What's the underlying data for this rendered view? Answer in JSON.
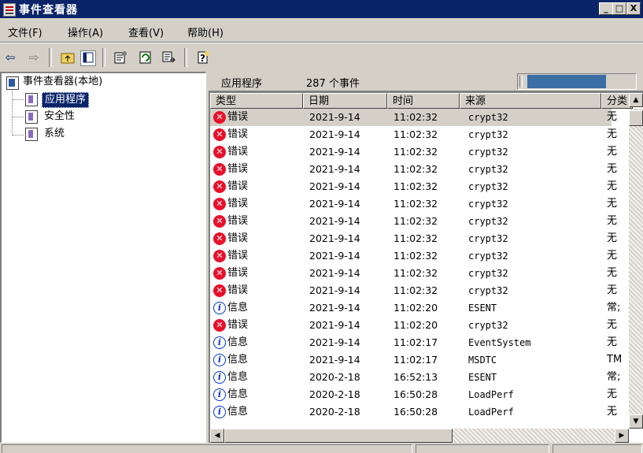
{
  "window": {
    "title": "事件查看器",
    "min_label": "_",
    "max_label": "□",
    "close_label": "X"
  },
  "menu": [
    {
      "label": "文件(F)"
    },
    {
      "label": "操作(A)"
    },
    {
      "label": "查看(V)"
    },
    {
      "label": "帮助(H)"
    }
  ],
  "toolbar": {
    "icons": [
      "back-arrow-icon",
      "forward-arrow-icon",
      "up-folder-icon",
      "show-hide-tree-icon",
      "properties-icon",
      "refresh-icon",
      "export-list-icon",
      "help-icon"
    ]
  },
  "tree": {
    "root": "事件查看器(本地)",
    "items": [
      {
        "label": "应用程序",
        "selected": true
      },
      {
        "label": "安全性"
      },
      {
        "label": "系统"
      }
    ]
  },
  "pane": {
    "title": "应用程序",
    "count": "287 个事件",
    "progress": 0.667
  },
  "columns": [
    "类型",
    "日期",
    "时间",
    "来源",
    "分类"
  ],
  "events": [
    {
      "type": "error",
      "type_label": "错误",
      "date": "2021-9-14",
      "time": "11:02:32",
      "source": "crypt32",
      "category": "无"
    },
    {
      "type": "error",
      "type_label": "错误",
      "date": "2021-9-14",
      "time": "11:02:32",
      "source": "crypt32",
      "category": "无"
    },
    {
      "type": "error",
      "type_label": "错误",
      "date": "2021-9-14",
      "time": "11:02:32",
      "source": "crypt32",
      "category": "无"
    },
    {
      "type": "error",
      "type_label": "错误",
      "date": "2021-9-14",
      "time": "11:02:32",
      "source": "crypt32",
      "category": "无"
    },
    {
      "type": "error",
      "type_label": "错误",
      "date": "2021-9-14",
      "time": "11:02:32",
      "source": "crypt32",
      "category": "无"
    },
    {
      "type": "error",
      "type_label": "错误",
      "date": "2021-9-14",
      "time": "11:02:32",
      "source": "crypt32",
      "category": "无"
    },
    {
      "type": "error",
      "type_label": "错误",
      "date": "2021-9-14",
      "time": "11:02:32",
      "source": "crypt32",
      "category": "无"
    },
    {
      "type": "error",
      "type_label": "错误",
      "date": "2021-9-14",
      "time": "11:02:32",
      "source": "crypt32",
      "category": "无"
    },
    {
      "type": "error",
      "type_label": "错误",
      "date": "2021-9-14",
      "time": "11:02:32",
      "source": "crypt32",
      "category": "无"
    },
    {
      "type": "error",
      "type_label": "错误",
      "date": "2021-9-14",
      "time": "11:02:32",
      "source": "crypt32",
      "category": "无"
    },
    {
      "type": "error",
      "type_label": "错误",
      "date": "2021-9-14",
      "time": "11:02:32",
      "source": "crypt32",
      "category": "无"
    },
    {
      "type": "info",
      "type_label": "信息",
      "date": "2021-9-14",
      "time": "11:02:20",
      "source": "ESENT",
      "category": "常;"
    },
    {
      "type": "error",
      "type_label": "错误",
      "date": "2021-9-14",
      "time": "11:02:20",
      "source": "crypt32",
      "category": "无"
    },
    {
      "type": "info",
      "type_label": "信息",
      "date": "2021-9-14",
      "time": "11:02:17",
      "source": "EventSystem",
      "category": "无"
    },
    {
      "type": "info",
      "type_label": "信息",
      "date": "2021-9-14",
      "time": "11:02:17",
      "source": "MSDTC",
      "category": "TM"
    },
    {
      "type": "info",
      "type_label": "信息",
      "date": "2020-2-18",
      "time": "16:52:13",
      "source": "ESENT",
      "category": "常;"
    },
    {
      "type": "info",
      "type_label": "信息",
      "date": "2020-2-18",
      "time": "16:50:28",
      "source": "LoadPerf",
      "category": "无"
    },
    {
      "type": "info",
      "type_label": "信息",
      "date": "2020-2-18",
      "time": "16:50:28",
      "source": "LoadPerf",
      "category": "无"
    }
  ],
  "colors": {
    "titlebar": "#0a246a",
    "selection": "#0a246a",
    "error": "#e8102a",
    "info": "#0033cc",
    "progress_fill": "#3a6ea5"
  }
}
